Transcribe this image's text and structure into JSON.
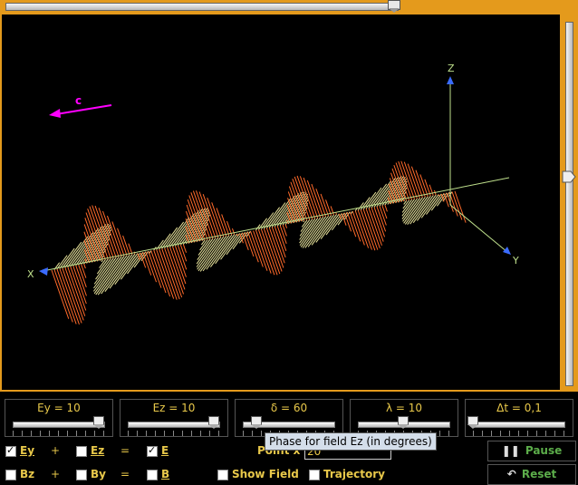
{
  "scene": {
    "axes": {
      "x": "X",
      "y": "Y",
      "z": "Z"
    },
    "velocity_label": "c",
    "colors": {
      "ey_field": "#e8e39a",
      "ez_field": "#ff6a2a",
      "axis": "#bfe08c",
      "velocity": "#ff00ff",
      "frame": "#e49a1c"
    }
  },
  "params": [
    {
      "label": "Ey = 10",
      "fraction": 0.95
    },
    {
      "label": "Ez = 10",
      "fraction": 0.95
    },
    {
      "label": "δ = 60",
      "fraction": 0.15
    },
    {
      "label": "λ = 10",
      "fraction": 0.5
    },
    {
      "label": "Δt = 0,1",
      "fraction": 0.0
    }
  ],
  "top_slider_fraction": 0.99,
  "right_slider_fraction": 0.42,
  "options": {
    "row1": [
      {
        "label": "Ey",
        "checked": true
      },
      {
        "label": "Ez",
        "checked": false
      },
      {
        "label": "E",
        "checked": true
      }
    ],
    "row2": [
      {
        "label": "Bz",
        "checked": false
      },
      {
        "label": "By",
        "checked": false
      },
      {
        "label": "B",
        "checked": false
      }
    ],
    "plus": "+",
    "equals": "=",
    "show_field": {
      "label": "Show Field",
      "checked": false
    },
    "trajectory": {
      "label": "Trajectory",
      "checked": false
    }
  },
  "point_x": {
    "label": "Point x =",
    "value": "20"
  },
  "tooltip": "Phase for field Ez (in degrees)",
  "buttons": {
    "pause": "Pause",
    "reset": "Reset"
  }
}
